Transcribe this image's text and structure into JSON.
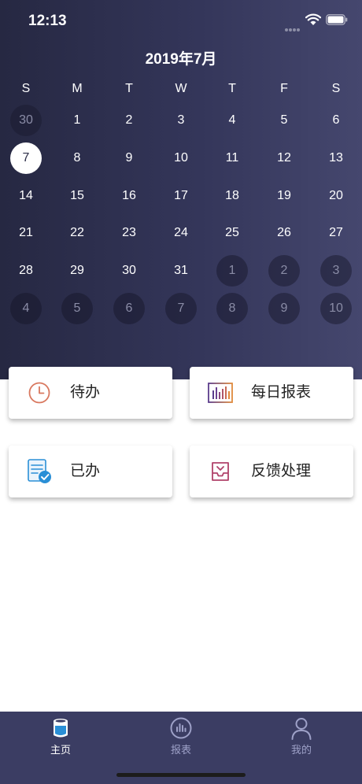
{
  "status_bar": {
    "time": "12:13"
  },
  "calendar": {
    "month_title": "2019年7月",
    "weekdays": [
      "S",
      "M",
      "T",
      "W",
      "T",
      "F",
      "S"
    ],
    "weeks": [
      [
        "30",
        "1",
        "2",
        "3",
        "4",
        "5",
        "6"
      ],
      [
        "7",
        "8",
        "9",
        "10",
        "11",
        "12",
        "13"
      ],
      [
        "14",
        "15",
        "16",
        "17",
        "18",
        "19",
        "20"
      ],
      [
        "21",
        "22",
        "23",
        "24",
        "25",
        "26",
        "27"
      ],
      [
        "28",
        "29",
        "30",
        "31",
        "1",
        "2",
        "3"
      ],
      [
        "4",
        "5",
        "6",
        "7",
        "8",
        "9",
        "10"
      ]
    ],
    "selected_day": "7"
  },
  "actions": {
    "todo_label": "待办",
    "daily_report_label": "每日报表",
    "done_label": "已办",
    "feedback_label": "反馈处理"
  },
  "tabbar": {
    "home_label": "主页",
    "report_label": "报表",
    "mine_label": "我的"
  },
  "colors": {
    "header_dark": "#262842",
    "header_light": "#45476e",
    "tabbar_bg": "#3b3d63",
    "todo_icon": "#d9785f",
    "report_icon_start": "#5a3c8c",
    "report_icon_end": "#e08a3c",
    "done_icon": "#2a8fd6",
    "feedback_icon": "#b0426a",
    "tab_inactive": "#9ea1c8"
  }
}
